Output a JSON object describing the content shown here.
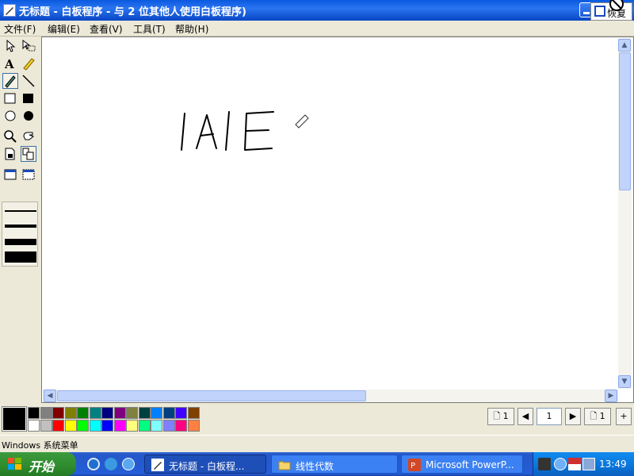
{
  "window": {
    "title": "无标题 - 白板程序 - 与 2 位其他人使用白板程序)",
    "restore_tooltip": "恢复"
  },
  "menu": [
    {
      "label": "文件(F)"
    },
    {
      "label": "编辑(E)"
    },
    {
      "label": "查看(V)"
    },
    {
      "label": "工具(T)"
    },
    {
      "label": "帮助(H)"
    }
  ],
  "tools": [
    "select-arrow-icon",
    "select-area-icon",
    "text-icon",
    "highlighter-icon",
    "pen-icon",
    "line-icon",
    "unfilled-rect-icon",
    "filled-rect-icon",
    "unfilled-ellipse-icon",
    "filled-ellipse-icon",
    "zoom-icon",
    "remote-pointer-icon",
    "lock-contents-icon",
    "synchronize-icon",
    "select-window-icon",
    "select-area-capture-icon"
  ],
  "canvas": {
    "drawn_text": "IAIE"
  },
  "palette": {
    "current": "#000000",
    "colors_top": [
      "#000000",
      "#808080",
      "#800000",
      "#808000",
      "#008000",
      "#008080",
      "#000080",
      "#800080",
      "#808040",
      "#004040",
      "#0080ff",
      "#004080",
      "#4000ff",
      "#804000"
    ],
    "colors_bottom": [
      "#ffffff",
      "#c0c0c0",
      "#ff0000",
      "#ffff00",
      "#00ff00",
      "#00ffff",
      "#0000ff",
      "#ff00ff",
      "#ffff80",
      "#00ff80",
      "#80ffff",
      "#8080ff",
      "#ff0080",
      "#ff8040"
    ]
  },
  "pages": {
    "first_label": "1",
    "current": "1",
    "last_label": "1"
  },
  "status": {
    "text": "Windows 系统菜单"
  },
  "taskbar": {
    "start_label": "开始",
    "tasks": [
      {
        "label": "无标题 - 白板程...",
        "icon": "whiteboard-icon"
      },
      {
        "label": "线性代数",
        "icon": "folder-icon"
      },
      {
        "label": "Microsoft PowerP...",
        "icon": "powerpoint-icon"
      }
    ],
    "clock": "13:49"
  }
}
